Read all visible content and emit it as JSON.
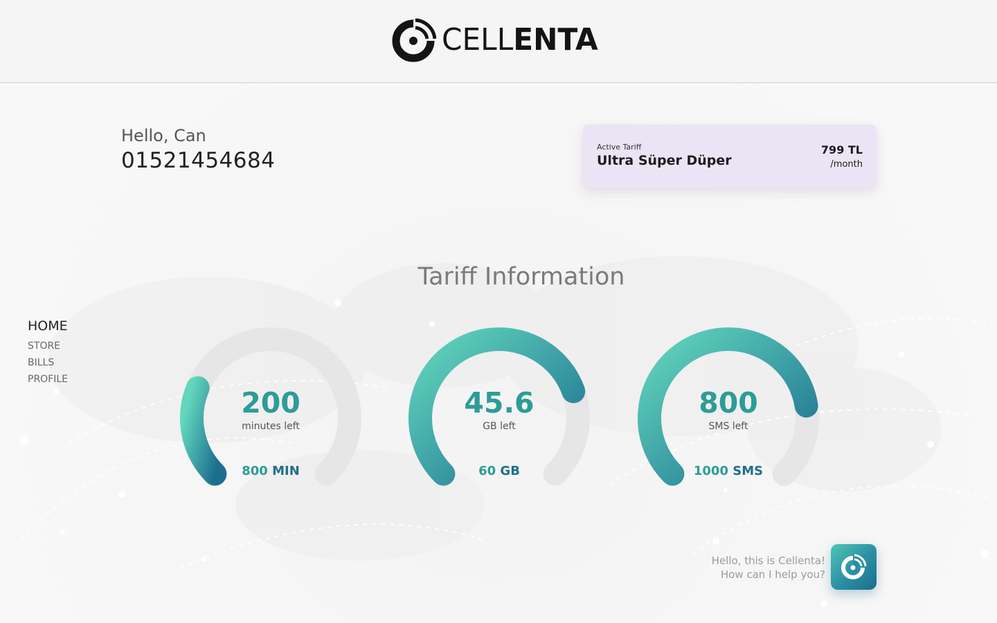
{
  "brand": {
    "name_light": "CELL",
    "name_bold": "ENTA",
    "accent_teal": "#2d9c96",
    "accent_blue": "#1f6f8b",
    "card_purple": "#ebe4f5"
  },
  "user": {
    "greeting": "Hello, Can",
    "phone": "01521454684"
  },
  "tariff_card": {
    "label": "Active Tariff",
    "name": "Ultra Süper Düper",
    "price": "799 TL",
    "period": "/month"
  },
  "section_title": "Tariff Information",
  "nav": {
    "items": [
      {
        "label": "HOME",
        "active": true
      },
      {
        "label": "STORE",
        "active": false
      },
      {
        "label": "BILLS",
        "active": false
      },
      {
        "label": "PROFILE",
        "active": false
      }
    ]
  },
  "gauges": [
    {
      "remaining": "200",
      "remaining_label": "minutes left",
      "total_value": "800",
      "total_unit": "MIN",
      "fraction": 0.25
    },
    {
      "remaining": "45.6",
      "remaining_label": "GB left",
      "total_value": "60",
      "total_unit": "GB",
      "fraction": 0.76
    },
    {
      "remaining": "800",
      "remaining_label": "SMS left",
      "total_value": "1000",
      "total_unit": "SMS",
      "fraction": 0.8
    }
  ],
  "chat": {
    "line1": "Hello, this is Cellenta!",
    "line2": "How can I help you?",
    "icon": "cellenta-signal-icon"
  }
}
